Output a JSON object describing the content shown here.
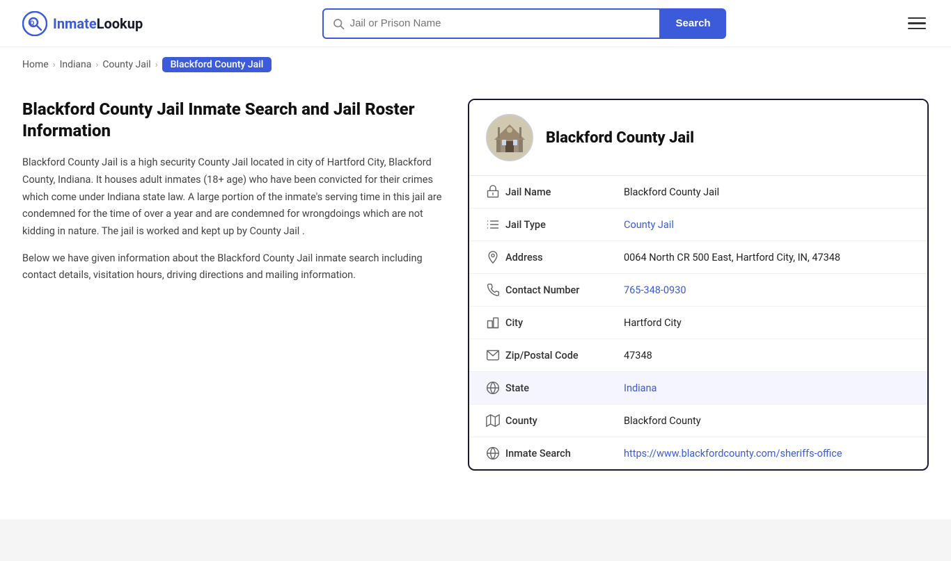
{
  "site": {
    "logo_text_1": "Inmate",
    "logo_text_2": "Lookup"
  },
  "header": {
    "search_placeholder": "Jail or Prison Name",
    "search_button": "Search"
  },
  "breadcrumb": {
    "home": "Home",
    "state": "Indiana",
    "type": "County Jail",
    "current": "Blackford County Jail"
  },
  "left": {
    "title": "Blackford County Jail Inmate Search and Jail Roster Information",
    "desc1": "Blackford County Jail is a high security County Jail located in city of Hartford City, Blackford County, Indiana. It houses adult inmates (18+ age) who have been convicted for their crimes which come under Indiana state law. A large portion of the inmate's serving time in this jail are condemned for the time of over a year and are condemned for wrongdoings which are not kidding in nature. The jail is worked and kept up by County Jail .",
    "desc2": "Below we have given information about the Blackford County Jail inmate search including contact details, visitation hours, driving directions and mailing information."
  },
  "card": {
    "jail_name": "Blackford County Jail",
    "rows": [
      {
        "label": "Jail Name",
        "value": "Blackford County Jail",
        "link": null,
        "shaded": false
      },
      {
        "label": "Jail Type",
        "value": "County Jail",
        "link": "#",
        "shaded": false
      },
      {
        "label": "Address",
        "value": "0064 North CR 500 East, Hartford City, IN, 47348",
        "link": null,
        "shaded": false
      },
      {
        "label": "Contact Number",
        "value": "765-348-0930",
        "link": "tel:765-348-0930",
        "shaded": false
      },
      {
        "label": "City",
        "value": "Hartford City",
        "link": null,
        "shaded": false
      },
      {
        "label": "Zip/Postal Code",
        "value": "47348",
        "link": null,
        "shaded": false
      },
      {
        "label": "State",
        "value": "Indiana",
        "link": "#",
        "shaded": true
      },
      {
        "label": "County",
        "value": "Blackford County",
        "link": null,
        "shaded": false
      },
      {
        "label": "Inmate Search",
        "value": "https://www.blackfordcounty.com/sheriffs-office",
        "link": "https://www.blackfordcounty.com/sheriffs-office",
        "shaded": false
      }
    ]
  }
}
